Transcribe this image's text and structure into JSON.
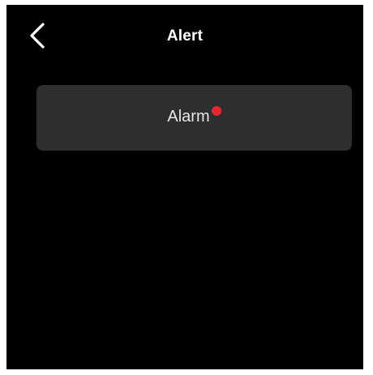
{
  "header": {
    "title": "Alert",
    "back_icon": "chevron-left-icon"
  },
  "list": {
    "items": [
      {
        "label": "Alarm",
        "badge_color": "#e8262f"
      }
    ]
  },
  "colors": {
    "background": "#000000",
    "card": "#2e2e2e",
    "text": "#ffffff"
  }
}
